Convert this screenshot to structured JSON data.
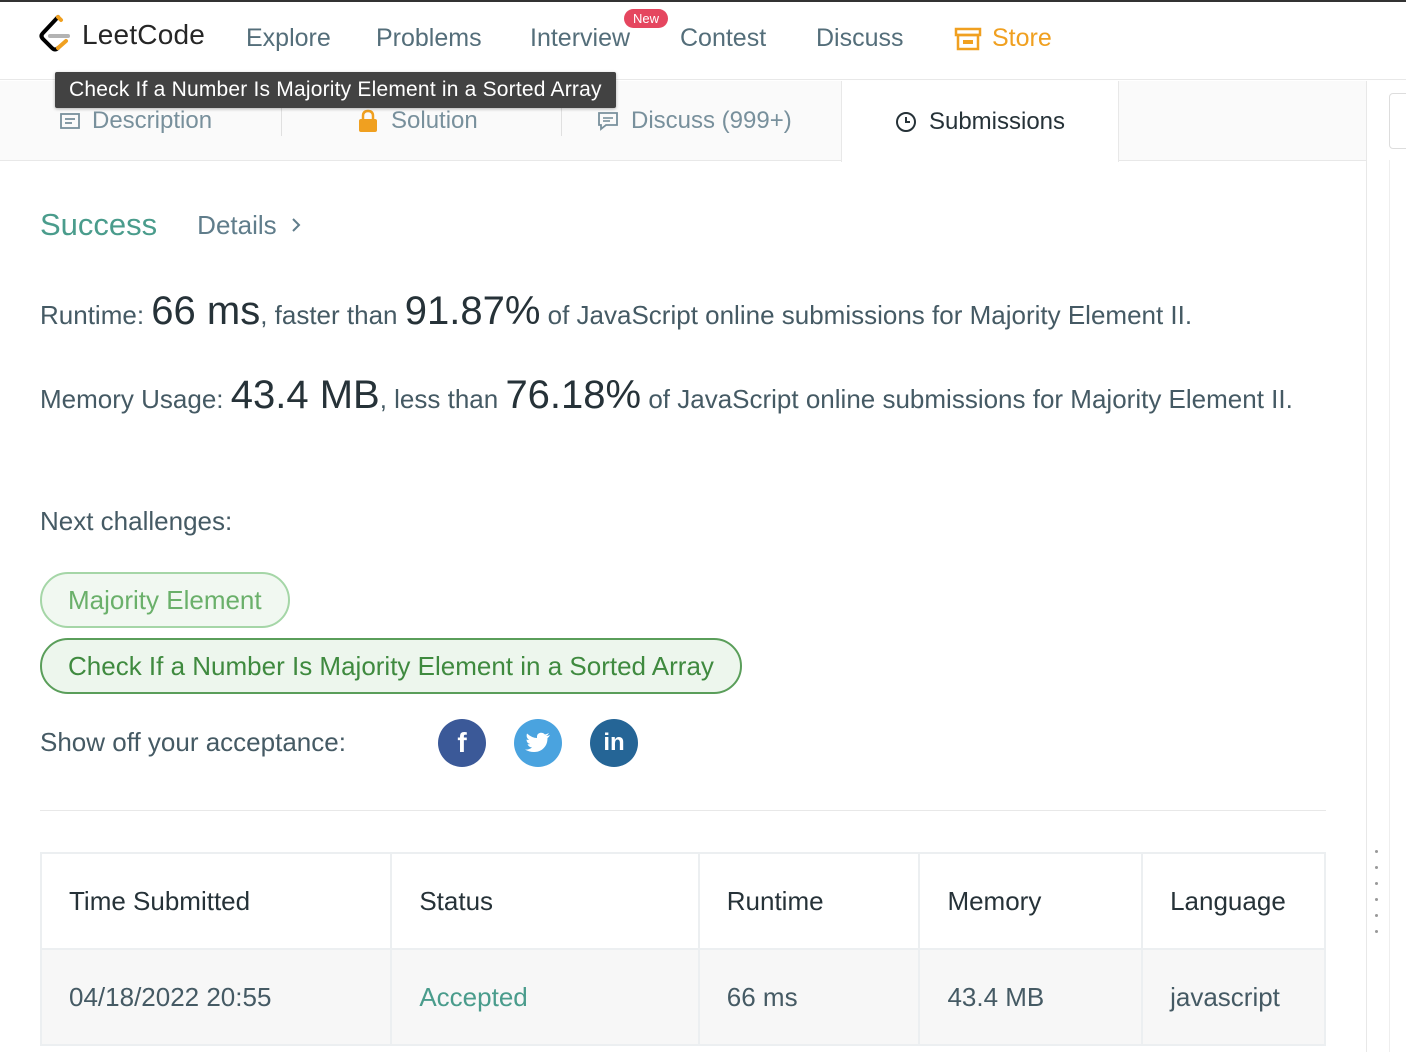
{
  "nav": {
    "logo_text": "LeetCode",
    "items": [
      "Explore",
      "Problems",
      "Interview",
      "Contest",
      "Discuss"
    ],
    "new_badge": "New",
    "store": "Store"
  },
  "tooltip": "Check If a Number Is Majority Element in a Sorted Array",
  "tabs": {
    "description": "Description",
    "solution": "Solution",
    "discuss": "Discuss (999+)",
    "submissions": "Submissions"
  },
  "result": {
    "status": "Success",
    "details": "Details",
    "runtime_label": "Runtime: ",
    "runtime_value": "66 ms",
    "runtime_mid": ", faster than ",
    "runtime_pct": "91.87%",
    "runtime_tail": " of JavaScript online submissions for Majority Element II.",
    "memory_label": "Memory Usage: ",
    "memory_value": "43.4 MB",
    "memory_mid": ", less than ",
    "memory_pct": "76.18%",
    "memory_tail": " of JavaScript online submissions for Majority Element II."
  },
  "next": {
    "label": "Next challenges:",
    "challenges": [
      "Majority Element",
      "Check If a Number Is Majority Element in a Sorted Array"
    ]
  },
  "share": {
    "label": "Show off your acceptance:",
    "icons": [
      "facebook-icon",
      "twitter-icon",
      "linkedin-icon"
    ]
  },
  "table": {
    "headers": [
      "Time Submitted",
      "Status",
      "Runtime",
      "Memory",
      "Language"
    ],
    "rows": [
      [
        "04/18/2022 20:55",
        "Accepted",
        "66 ms",
        "43.4 MB",
        "javascript"
      ]
    ]
  },
  "colors": {
    "accent": "#4a9c8c",
    "store": "#f0a020",
    "badge": "#e5465f"
  }
}
